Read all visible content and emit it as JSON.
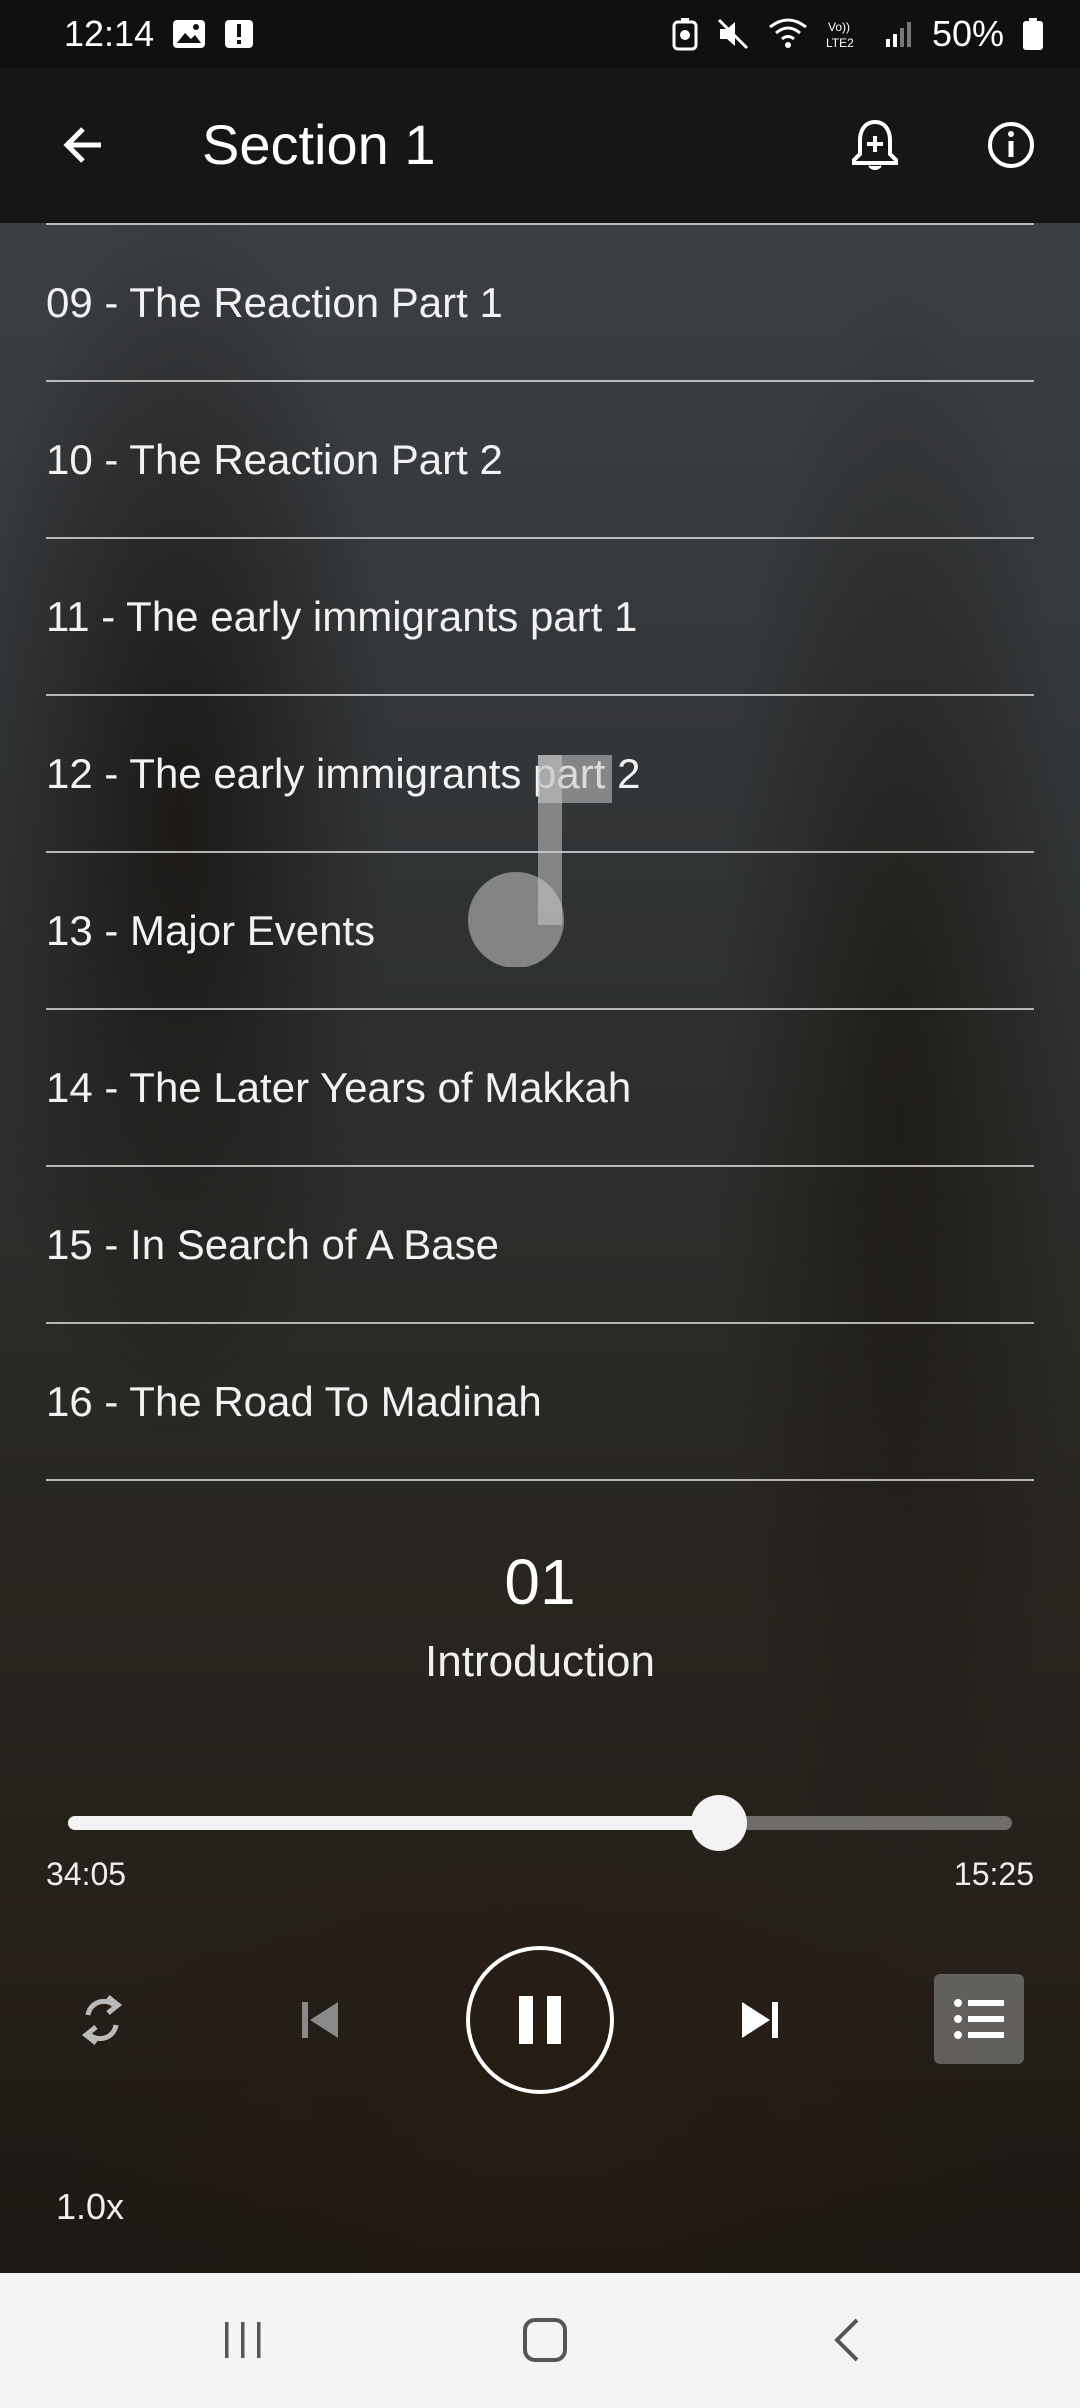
{
  "status_bar": {
    "time": "12:14",
    "battery": "50%",
    "icons": [
      "image-icon",
      "alert-icon",
      "battery-saver-icon",
      "mute-icon",
      "wifi-icon",
      "volte-icon",
      "signal-icon",
      "battery-icon"
    ]
  },
  "app_bar": {
    "title": "Section 1",
    "icons": [
      "back-arrow-icon",
      "add-alert-icon",
      "info-icon"
    ]
  },
  "tracks": [
    "09 - The Reaction Part 1",
    "10 - The Reaction Part 2",
    "11 - The early immigrants part 1",
    "12 - The early immigrants part 2",
    "13 - Major Events",
    "14 - The Later Years of Makkah",
    "15 - In Search of A Base",
    "16 - The Road To Madinah"
  ],
  "now_playing": {
    "number": "01",
    "title": "Introduction",
    "elapsed": "34:05",
    "remaining": "15:25",
    "progress": 0.69,
    "speed": "1.0x"
  },
  "controls": [
    "repeat-icon",
    "previous-icon",
    "pause-icon",
    "next-icon",
    "playlist-icon"
  ],
  "nav_bar": [
    "recents-icon",
    "home-icon",
    "back-icon"
  ],
  "colors": {
    "accent": "#ffffff",
    "appbar": "#161616",
    "navbar": "#f4f4f4"
  }
}
